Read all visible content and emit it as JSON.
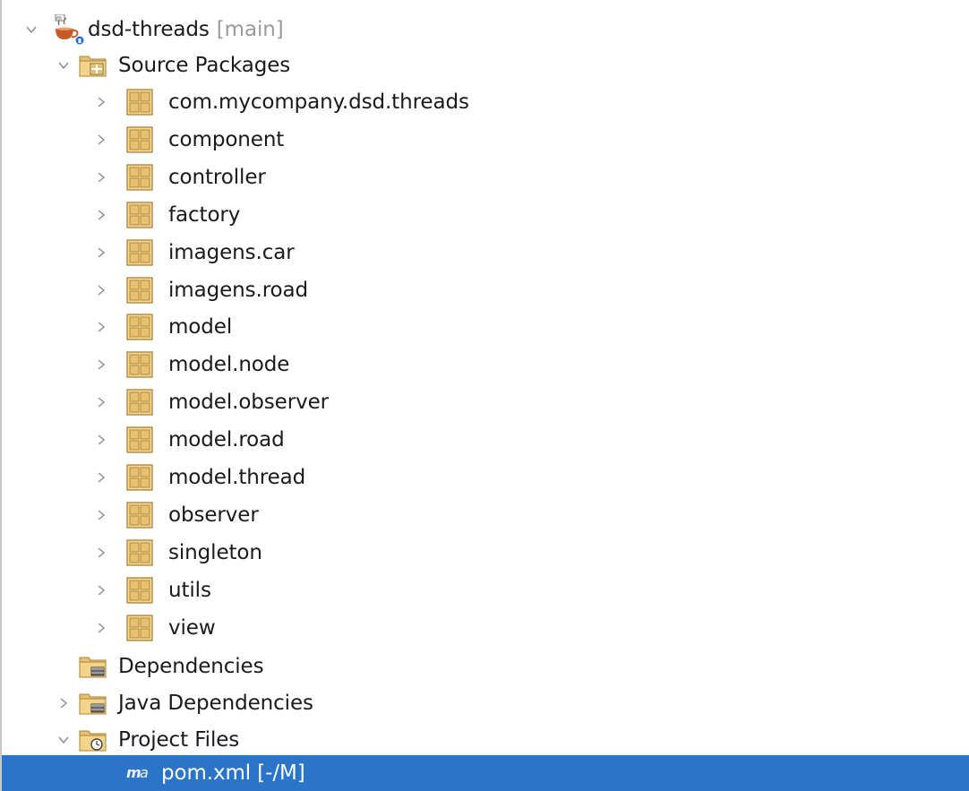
{
  "project": {
    "name": "dsd-threads",
    "branch": "[main]",
    "icon": "maven-java-project-icon"
  },
  "source_packages": {
    "label": "Source Packages",
    "packages": [
      "com.mycompany.dsd.threads",
      "component",
      "controller",
      "factory",
      "imagens.car",
      "imagens.road",
      "model",
      "model.node",
      "model.observer",
      "model.road",
      "model.thread",
      "observer",
      "singleton",
      "utils",
      "view"
    ]
  },
  "dependencies": {
    "label": "Dependencies"
  },
  "java_dependencies": {
    "label": "Java Dependencies"
  },
  "project_files": {
    "label": "Project Files",
    "files": [
      {
        "label": "pom.xml [-/M]",
        "icon": "maven-pom-icon",
        "selected": true
      }
    ]
  },
  "colors": {
    "selection": "#2a75c9",
    "package_icon": "#e8c070",
    "chevron": "#8a8a8a",
    "branch_text": "#9a9a9a"
  }
}
